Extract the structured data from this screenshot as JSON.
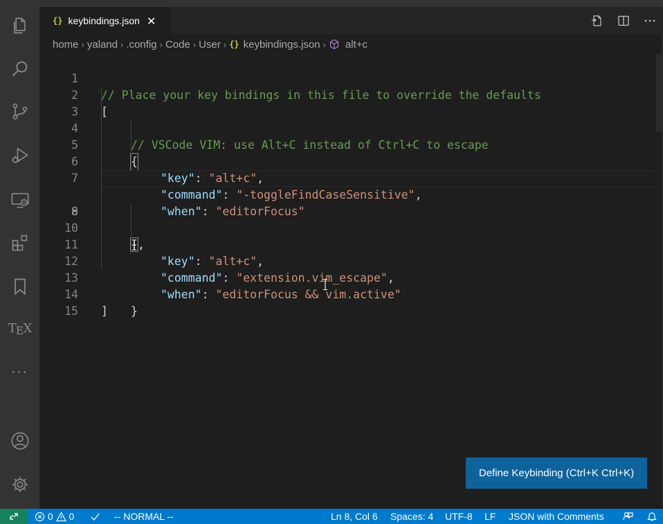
{
  "tab": {
    "icon": "json-braces-icon",
    "label": "keybindings.json",
    "close": "✕"
  },
  "breadcrumb": {
    "items": [
      "home",
      "yaland",
      ".config",
      "Code",
      "User",
      "keybindings.json",
      "alt+c"
    ]
  },
  "activity_bar": {
    "icons": [
      "files-icon",
      "search-icon",
      "source-control-icon",
      "run-debug-icon",
      "remote-explorer-icon",
      "extensions-icon",
      "bookmark-icon",
      "tex-icon",
      "more-icon",
      "account-icon",
      "settings-gear-icon"
    ],
    "tex_label_t": "T",
    "tex_label_e": "E",
    "tex_label_x": "X",
    "more": "···"
  },
  "editor": {
    "active_line": 8,
    "lines": [
      {
        "n": "1"
      },
      {
        "n": "2"
      },
      {
        "n": "3"
      },
      {
        "n": "4"
      },
      {
        "n": "5"
      },
      {
        "n": "6"
      },
      {
        "n": "7"
      },
      {
        "n": "8"
      },
      {
        "n": "9"
      },
      {
        "n": "10"
      },
      {
        "n": "11"
      },
      {
        "n": "12"
      },
      {
        "n": "13"
      },
      {
        "n": "14"
      },
      {
        "n": "15"
      }
    ],
    "code": {
      "l1": "// Place your key bindings in this file to override the defaults",
      "l2": "[",
      "l3": "// VSCode VIM: use Alt+C instead of Ctrl+C to escape",
      "l4": "{",
      "l5_key": "\"key\"",
      "l5_val": "\"alt+c\"",
      "l6_key": "\"command\"",
      "l6_val": "\"-toggleFindCaseSensitive\"",
      "l7_key": "\"when\"",
      "l7_val": "\"editorFocus\"",
      "l8": "}",
      "l9": "{",
      "l10_key": "\"key\"",
      "l10_val": "\"alt+c\"",
      "l11_key": "\"command\"",
      "l11_val": "\"extension.vim_escape\"",
      "l12_key": "\"when\"",
      "l12_val": "\"editorFocus && vim.active\"",
      "l13": "}",
      "l14": "]"
    }
  },
  "define_keybinding": {
    "label": "Define Keybinding (Ctrl+K Ctrl+K)"
  },
  "statusbar": {
    "errors": "0",
    "warnings": "0",
    "vim_mode": "-- NORMAL --",
    "position": "Ln 8, Col 6",
    "spaces": "Spaces: 4",
    "encoding": "UTF-8",
    "eol": "LF",
    "language": "JSON with Comments"
  },
  "colors": {
    "accent": "#007acc",
    "remote": "#16825d",
    "button": "#0e639c",
    "comment": "#6a9955",
    "key": "#9cdcfe",
    "string": "#ce9178"
  }
}
